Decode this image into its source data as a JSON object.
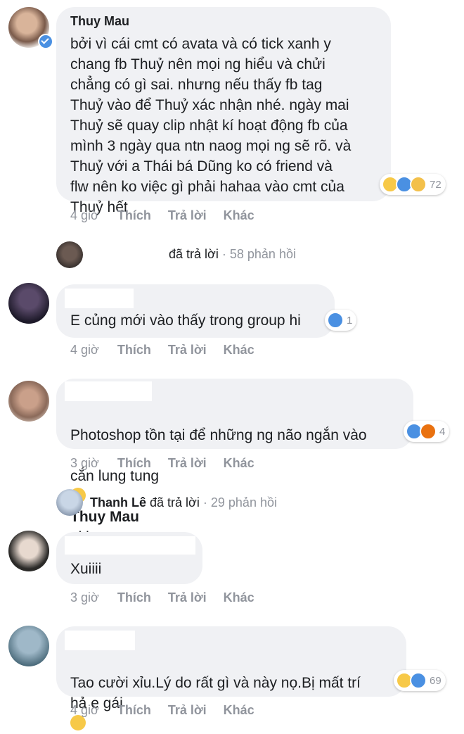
{
  "comments": [
    {
      "name": "Thuy Mau",
      "text": "bởi vì cái cmt có avata và có tick xanh y\nchang fb Thuỷ nên mọi ng hiểu và chửi\nchẳng có gì sai. nhưng nếu thấy fb tag\nThuỷ vào để Thuỷ xác nhận nhé. ngày mai\nThuỷ sẽ quay clip nhật kí hoạt động fb của\nmình 3 ngày qua ntn naog mọi ng sẽ rõ. và\nThuỷ với a Thái bá Dũng ko có friend và\nflw nên ko việc gì phải hahaa vào cmt của\nThuỷ hết",
      "reaction_count": "72",
      "reactions": [
        "haha",
        "like",
        "sad"
      ],
      "time": "4 giờ"
    },
    {
      "name": "",
      "text": "E củng mới vào thấy trong group hi",
      "reaction_count": "1",
      "reactions": [
        "like"
      ],
      "time": "4 giờ"
    },
    {
      "name": "",
      "text_line1": "Photoshop tồn tại để những ng não ngắn vào",
      "text_line2_before": "cắn lung tung",
      "mention": "Thuy Mau",
      "text_line2_after": "okie",
      "reaction_count": "4",
      "reactions": [
        "like",
        "angry"
      ],
      "time": "3 giờ"
    },
    {
      "name": "",
      "text": "Xuiiii",
      "time": "3 giờ"
    },
    {
      "name": "",
      "text": "Tao cười xỉu.Lý do rất gì và này nọ.Bị mất trí\nhả e gái",
      "reaction_count": "69",
      "reactions": [
        "haha",
        "like"
      ],
      "time": "4 giờ"
    }
  ],
  "actions": {
    "like": "Thích",
    "reply": "Trả lời",
    "more": "Khác"
  },
  "reply_summaries": [
    {
      "replier": "",
      "verb": "đã trả lời",
      "count": "58 phản hồi"
    },
    {
      "replier": "Thanh Lê",
      "verb": "đã trả lời",
      "count": "29 phản hồi"
    }
  ],
  "separator": "·",
  "colors": {
    "bubble": "#f0f1f4",
    "meta_text": "#90949c",
    "like_blue": "#4a90e2",
    "haha_yellow": "#f7c948",
    "angry_red": "#e9710f"
  }
}
